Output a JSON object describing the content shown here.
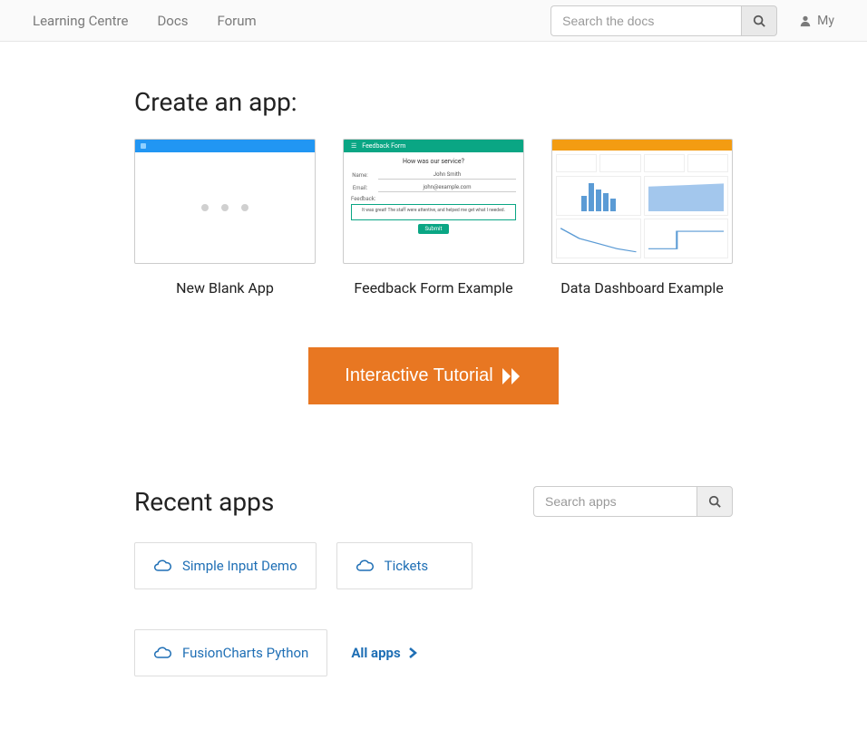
{
  "topbar": {
    "links": [
      "Learning Centre",
      "Docs",
      "Forum"
    ],
    "search_placeholder": "Search the docs",
    "user_label": "My"
  },
  "create": {
    "heading": "Create an app:",
    "templates": [
      {
        "title": "New Blank App"
      },
      {
        "title": "Feedback Form Example",
        "preview": {
          "header": "Feedback Form",
          "question": "How was our service?",
          "name_label": "Name:",
          "name_value": "John Smith",
          "email_label": "Email:",
          "email_value": "john@example.com",
          "feedback_label": "Feedback:",
          "feedback_value": "It was great!\nThe staff were attentive, and helped me get what I needed.",
          "submit": "Submit"
        }
      },
      {
        "title": "Data Dashboard Example"
      }
    ],
    "cta": "Interactive Tutorial"
  },
  "recent": {
    "heading": "Recent apps",
    "search_placeholder": "Search apps",
    "apps": [
      "Simple Input Demo",
      "Tickets",
      "FusionCharts Python"
    ],
    "all_apps": "All apps"
  }
}
